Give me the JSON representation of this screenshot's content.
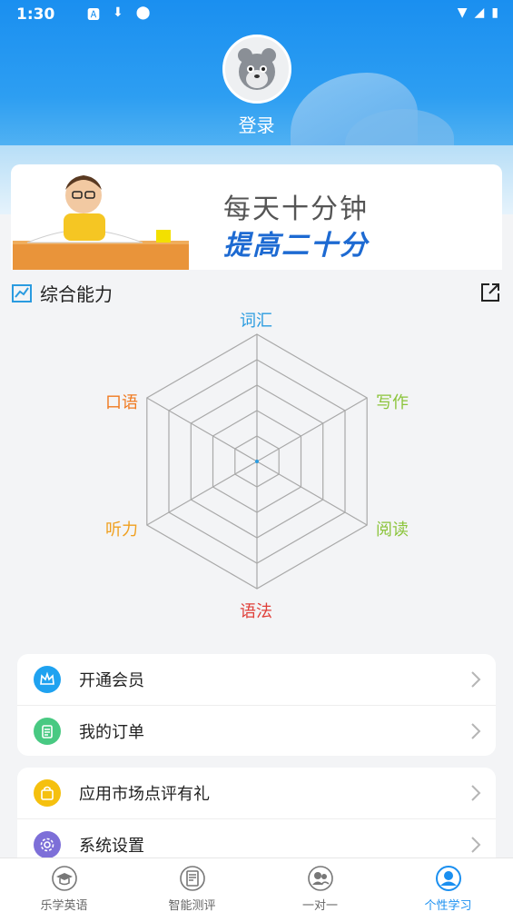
{
  "status_bar": {
    "time": "1:30"
  },
  "profile": {
    "login_label": "登录"
  },
  "banner": {
    "line1": "每天十分钟",
    "line2": "提高二十分"
  },
  "ability": {
    "title": "综合能力",
    "axes": [
      "词汇",
      "写作",
      "阅读",
      "语法",
      "听力",
      "口语"
    ],
    "axis_colors": [
      "#2a9be0",
      "#8bc43b",
      "#8bc43b",
      "#e0403a",
      "#f0a020",
      "#f07a20"
    ]
  },
  "menu": {
    "group1": [
      {
        "label": "开通会员",
        "icon": "crown-icon",
        "color": "#1fa2f0"
      },
      {
        "label": "我的订单",
        "icon": "clipboard-icon",
        "color": "#48c982"
      }
    ],
    "group2": [
      {
        "label": "应用市场点评有礼",
        "icon": "shopping-bag-icon",
        "color": "#f5c00e"
      },
      {
        "label": "系统设置",
        "icon": "gear-icon",
        "color": "#7d6fd8"
      }
    ]
  },
  "tabs": [
    {
      "label": "乐学英语",
      "icon": "graduation-cap-icon",
      "active": false
    },
    {
      "label": "智能测评",
      "icon": "document-icon",
      "active": false
    },
    {
      "label": "一对一",
      "icon": "people-icon",
      "active": false
    },
    {
      "label": "个性学习",
      "icon": "person-icon",
      "active": true
    }
  ],
  "colors": {
    "accent": "#1a8ff0",
    "tab_active": "#1a8ff0",
    "tab_inactive": "#666666"
  }
}
